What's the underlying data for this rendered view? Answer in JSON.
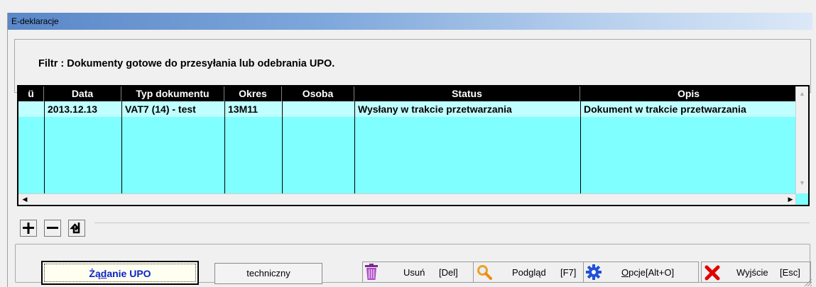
{
  "window": {
    "title": "E-deklaracje"
  },
  "filter": {
    "text": "Filtr : Dokumenty gotowe do przesyłania lub odebrania UPO."
  },
  "grid": {
    "columns": [
      "ü",
      "Data",
      "Typ dokumentu",
      "Okres",
      "Osoba",
      "Status",
      "Opis"
    ],
    "rows": [
      {
        "check": "",
        "data": "2013.12.13",
        "typ": "VAT7 (14) - test",
        "okres": "13M11",
        "osoba": "",
        "status": "Wysłany w trakcie przetwarzania",
        "opis": "Dokument w trakcie przetwarzania"
      }
    ]
  },
  "nav": {
    "add": "+",
    "remove": "−",
    "step": "step"
  },
  "buttons": {
    "upo": {
      "pre": "Żą",
      "accel": "d",
      "post": "anie UPO"
    },
    "techniczny": "techniczny",
    "usun": "Usuń",
    "usun_key": "[Del]",
    "podglad": "Podgląd",
    "podglad_key": "[F7]",
    "opcje": {
      "accel": "O",
      "post": "pcje[Alt+O]"
    },
    "wyjscie": "Wyjście",
    "wyjscie_key": "[Esc]"
  },
  "colors": {
    "grid_bg": "#7fffff",
    "selected_row": "#c0ffff",
    "header_bg": "#000000",
    "accent_blue": "#0c22c8",
    "close_red": "#e00000"
  },
  "icons": [
    "trash-icon",
    "magnifier-icon",
    "gear-icon",
    "close-x-icon"
  ]
}
